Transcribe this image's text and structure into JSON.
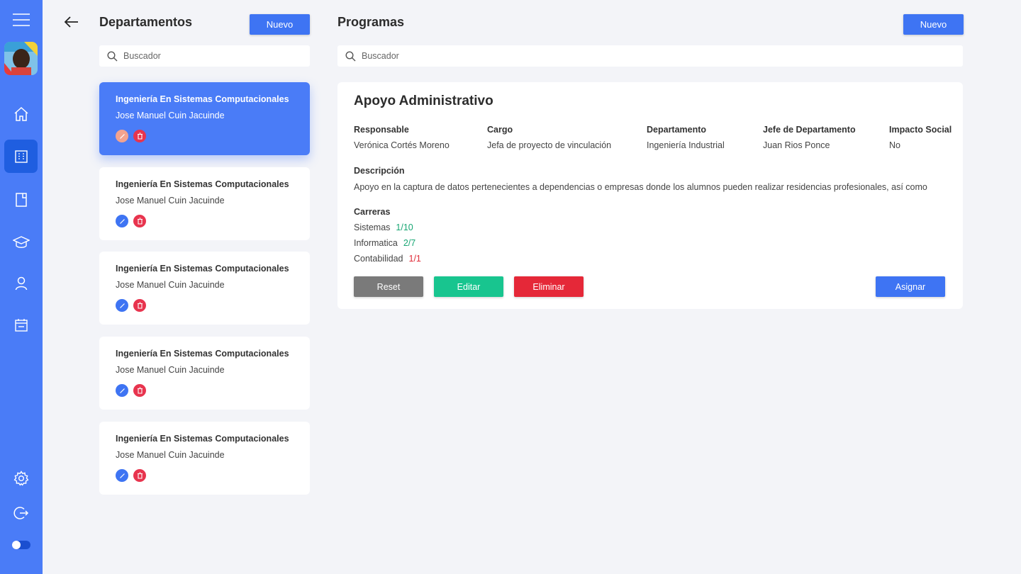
{
  "sidebar": {
    "icons": [
      "menu-icon",
      "home-icon",
      "building-icon",
      "document-icon",
      "graduation-cap-icon",
      "user-icon",
      "calendar-icon",
      "gear-icon",
      "logout-icon"
    ],
    "active_item": "building-icon",
    "accent_color": "#4a7cf7"
  },
  "departments": {
    "title": "Departamentos",
    "new_label": "Nuevo",
    "search_placeholder": "Buscador",
    "items": [
      {
        "title": "Ingeniería En Sistemas Computacionales",
        "subtitle": "Jose Manuel Cuin Jacuinde",
        "active": true
      },
      {
        "title": "Ingeniería En Sistemas Computacionales",
        "subtitle": "Jose Manuel Cuin Jacuinde",
        "active": false
      },
      {
        "title": "Ingeniería En Sistemas Computacionales",
        "subtitle": "Jose Manuel Cuin Jacuinde",
        "active": false
      },
      {
        "title": "Ingeniería En Sistemas Computacionales",
        "subtitle": "Jose Manuel Cuin Jacuinde",
        "active": false
      },
      {
        "title": "Ingeniería En Sistemas Computacionales",
        "subtitle": "Jose Manuel Cuin Jacuinde",
        "active": false
      }
    ]
  },
  "programs": {
    "title": "Programas",
    "new_label": "Nuevo",
    "search_placeholder": "Buscador",
    "detail": {
      "name": "Apoyo Administrativo",
      "fields": [
        {
          "label": "Responsable",
          "value": "Verónica Cortés Moreno"
        },
        {
          "label": "Cargo",
          "value": "Jefa de proyecto de vinculación"
        },
        {
          "label": "Departamento",
          "value": "Ingeniería Industrial"
        },
        {
          "label": "Jefe de Departamento",
          "value": "Juan Rios Ponce"
        },
        {
          "label": "Impacto Social",
          "value": "No"
        }
      ],
      "description_label": "Descripción",
      "description": "Apoyo en la captura de datos pertenecientes a dependencias o empresas donde los alumnos pueden realizar residencias profesionales, así como",
      "careers_label": "Carreras",
      "careers": [
        {
          "name": "Sistemas",
          "ratio": "1/10",
          "status_color": "#17a673"
        },
        {
          "name": "Informatica",
          "ratio": "2/7",
          "status_color": "#17a673"
        },
        {
          "name": "Contabilidad",
          "ratio": "1/1",
          "status_color": "#e02b38"
        }
      ],
      "buttons": {
        "reset": "Reset",
        "edit": "Editar",
        "delete": "Eliminar",
        "assign": "Asignar"
      }
    }
  }
}
